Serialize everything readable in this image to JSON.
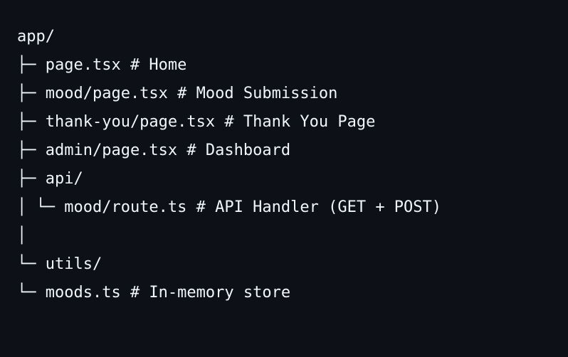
{
  "theme": {
    "background": "#0d1117",
    "text": "#f0f6fc"
  },
  "code": {
    "lines": [
      "app/",
      "├─ page.tsx # Home",
      "├─ mood/page.tsx # Mood Submission",
      "├─ thank-you/page.tsx # Thank You Page",
      "├─ admin/page.tsx # Dashboard",
      "├─ api/",
      "│ └─ mood/route.ts # API Handler (GET + POST)",
      "│",
      "└─ utils/",
      "└─ moods.ts # In-memory store"
    ]
  }
}
